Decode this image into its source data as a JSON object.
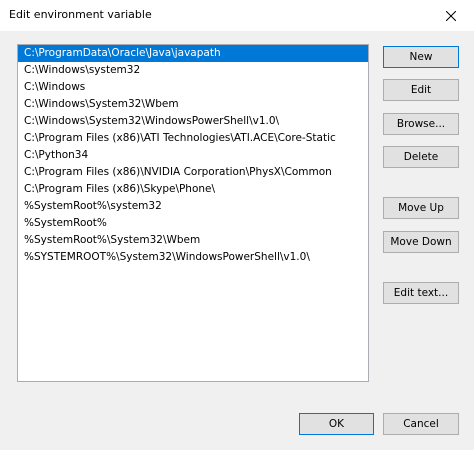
{
  "window": {
    "title": "Edit environment variable"
  },
  "paths": [
    "C:\\ProgramData\\Oracle\\Java\\javapath",
    "C:\\Windows\\system32",
    "C:\\Windows",
    "C:\\Windows\\System32\\Wbem",
    "C:\\Windows\\System32\\WindowsPowerShell\\v1.0\\",
    "C:\\Program Files (x86)\\ATI Technologies\\ATI.ACE\\Core-Static",
    "C:\\Python34",
    "C:\\Program Files (x86)\\NVIDIA Corporation\\PhysX\\Common",
    "C:\\Program Files (x86)\\Skype\\Phone\\",
    "%SystemRoot%\\system32",
    "%SystemRoot%",
    "%SystemRoot%\\System32\\Wbem",
    "%SYSTEMROOT%\\System32\\WindowsPowerShell\\v1.0\\"
  ],
  "selected_index": 0,
  "buttons": {
    "new": "New",
    "edit": "Edit",
    "browse": "Browse...",
    "delete": "Delete",
    "move_up": "Move Up",
    "move_down": "Move Down",
    "edit_text": "Edit text...",
    "ok": "OK",
    "cancel": "Cancel"
  },
  "colors": {
    "selection": "#0078d7",
    "dialog_bg": "#f0f0f0",
    "button_bg": "#e1e1e1"
  }
}
